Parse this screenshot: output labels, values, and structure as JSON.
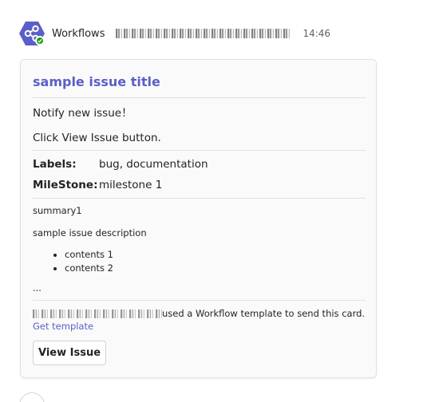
{
  "message": {
    "sender": "Workflows",
    "time": "14:46",
    "avatar_icon": "workflows-share-icon",
    "avatar_color": "#5b5fc7",
    "presence_color": "#13a10e"
  },
  "card": {
    "title": "sample issue title",
    "notify_text": "Notify new issue！",
    "click_text": "Click View Issue button.",
    "facts": [
      {
        "key": "Labels:",
        "value": "bug, documentation"
      },
      {
        "key": "MileStone:",
        "value": "milestone 1"
      }
    ],
    "summary": "summary1",
    "description": "sample issue description",
    "contents": [
      "contents 1",
      "contents 2"
    ],
    "ellipsis": "...",
    "footer_text": "used a Workflow template to send this card.",
    "footer_link": "Get template",
    "button_label": "View Issue",
    "accent_color": "#5b5fc7"
  }
}
